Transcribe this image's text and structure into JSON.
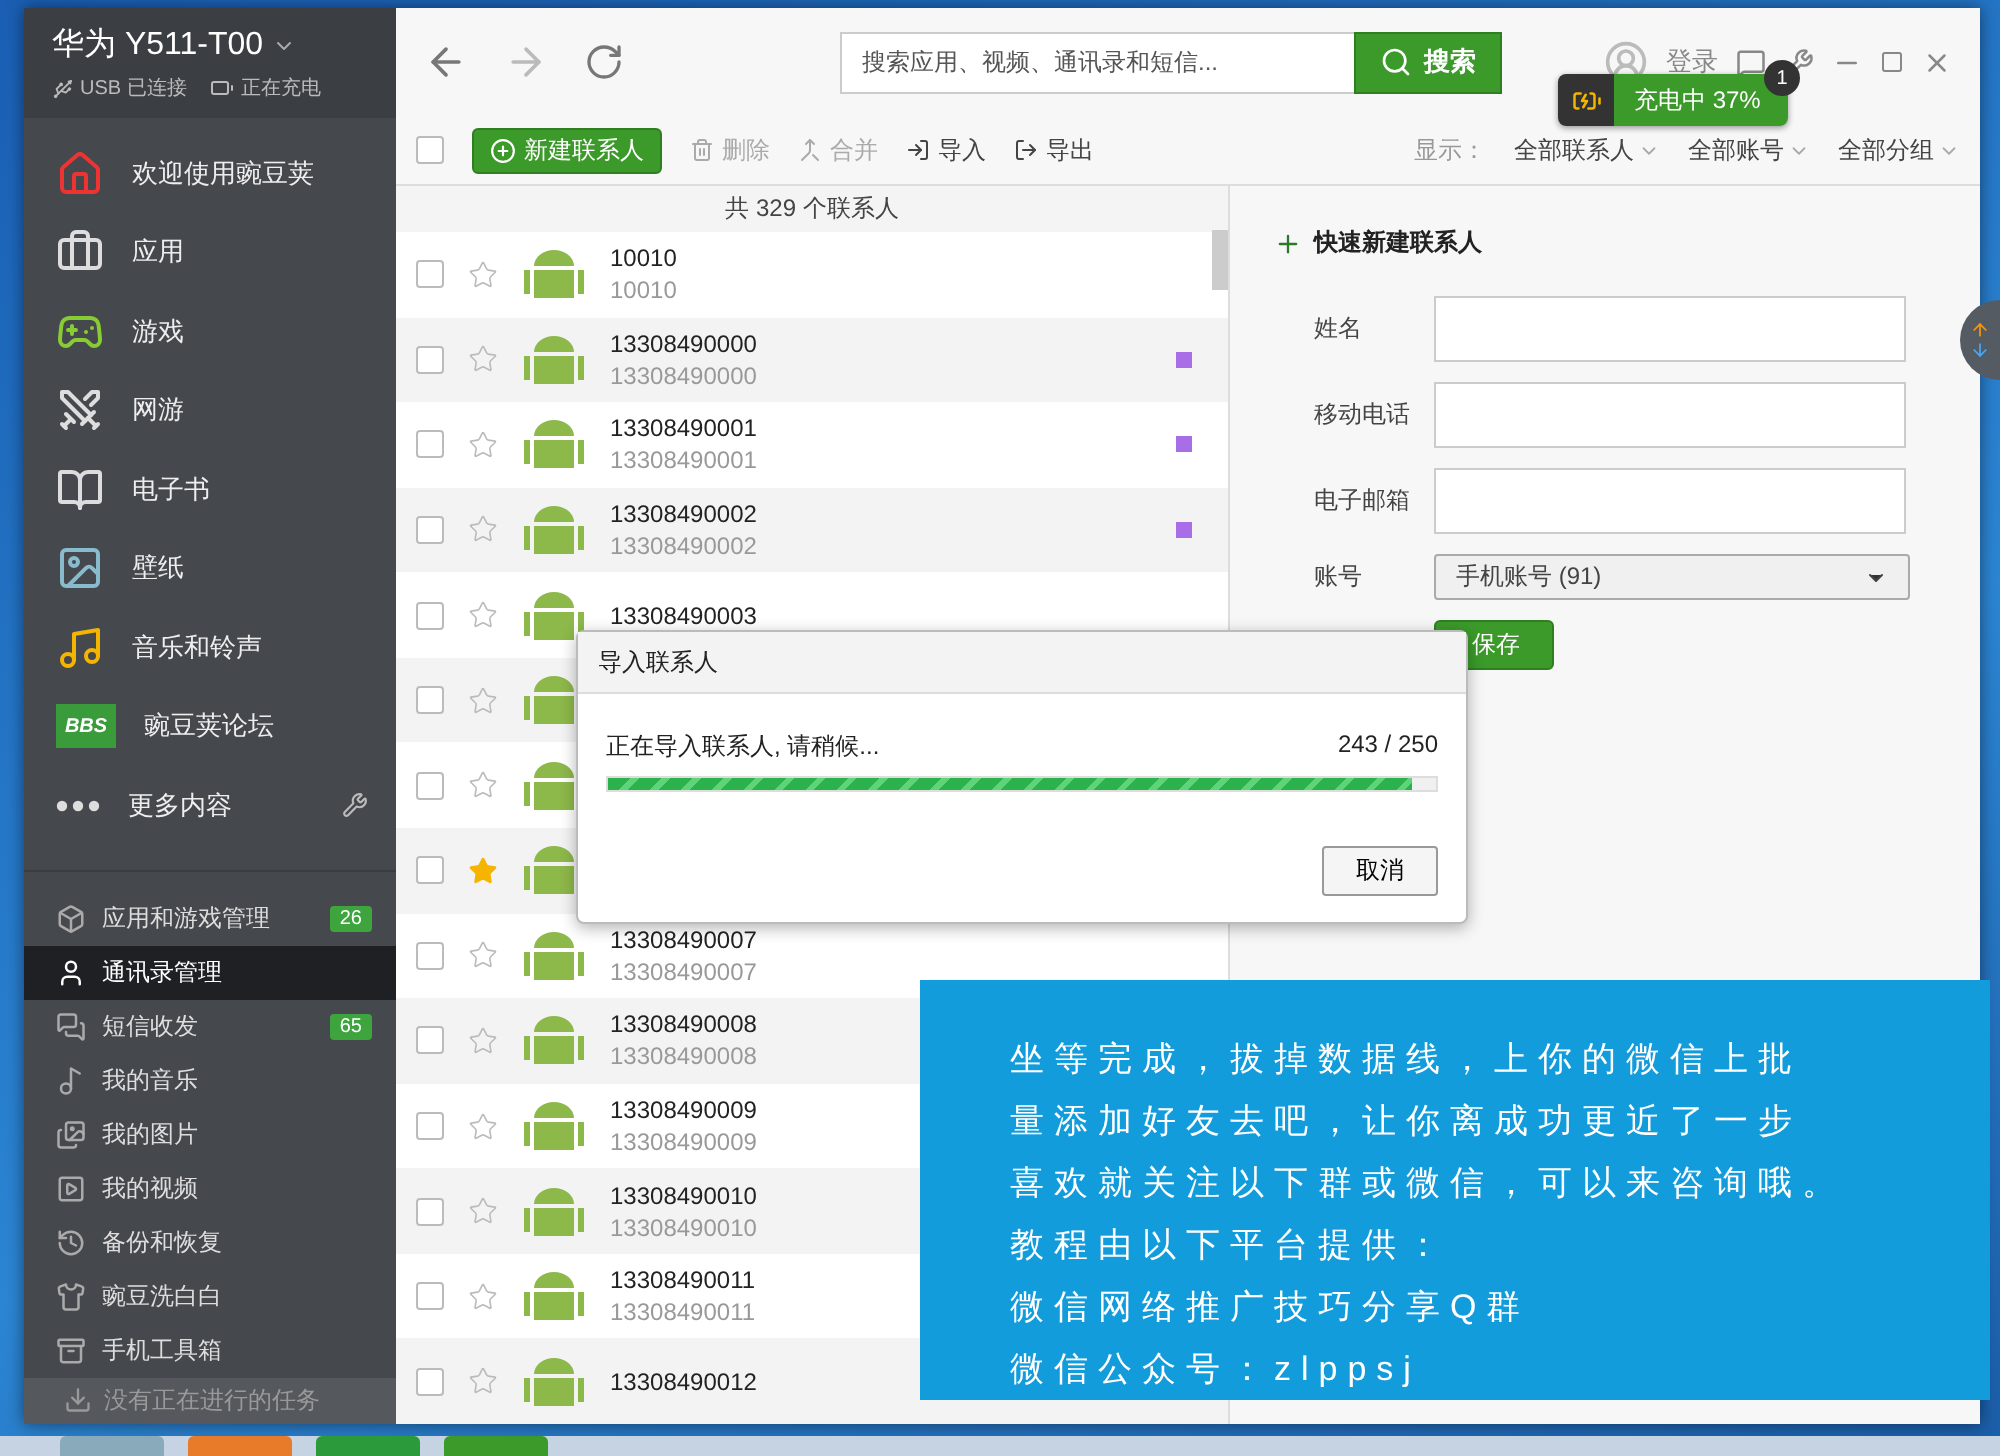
{
  "device": {
    "title": "华为 Y511-T00",
    "usb": "USB 已连接",
    "charging": "正在充电"
  },
  "sidebar": {
    "nav": [
      {
        "label": "欢迎使用豌豆荚"
      },
      {
        "label": "应用"
      },
      {
        "label": "游戏"
      },
      {
        "label": "网游"
      },
      {
        "label": "电子书"
      },
      {
        "label": "壁纸"
      },
      {
        "label": "音乐和铃声"
      },
      {
        "label": "豌豆荚论坛",
        "icon_text": "BBS"
      },
      {
        "label": "更多内容"
      }
    ],
    "manage": [
      {
        "label": "应用和游戏管理",
        "badge": "26",
        "selected": false
      },
      {
        "label": "通讯录管理",
        "selected": true
      },
      {
        "label": "短信收发",
        "badge": "65",
        "selected": false
      },
      {
        "label": "我的音乐",
        "selected": false
      },
      {
        "label": "我的图片",
        "selected": false
      },
      {
        "label": "我的视频",
        "selected": false
      },
      {
        "label": "备份和恢复",
        "selected": false
      },
      {
        "label": "豌豆洗白白",
        "selected": false
      },
      {
        "label": "手机工具箱",
        "selected": false
      }
    ],
    "tasks": "没有正在进行的任务"
  },
  "toolbar": {
    "search_placeholder": "搜索应用、视频、通讯录和短信...",
    "search_button": "搜索",
    "login": "登录"
  },
  "charge_popup": {
    "text": "充电中 37%",
    "badge": "1"
  },
  "actions": {
    "select_all_checked": false,
    "new": "新建联系人",
    "delete": "删除",
    "merge": "合并",
    "import": "导入",
    "export": "导出",
    "show_label": "显示：",
    "filters": [
      "全部联系人",
      "全部账号",
      "全部分组"
    ]
  },
  "contacts": {
    "count": "共 329 个联系人",
    "rows": [
      {
        "name": "10010",
        "number": "10010",
        "checked": false,
        "starred": false
      },
      {
        "name": "13308490000",
        "number": "13308490000",
        "checked": false,
        "starred": false,
        "color": "#a86ee8"
      },
      {
        "name": "13308490001",
        "number": "13308490001",
        "checked": false,
        "starred": false,
        "color": "#a86ee8"
      },
      {
        "name": "13308490002",
        "number": "13308490002",
        "checked": false,
        "starred": false,
        "color": "#a86ee8"
      },
      {
        "name": "13308490003",
        "checked": false,
        "starred": false
      },
      {
        "checked": false,
        "starred": false
      },
      {
        "checked": false,
        "starred": false
      },
      {
        "checked": false,
        "starred": true
      },
      {
        "name": "13308490007",
        "number": "13308490007",
        "checked": false,
        "starred": false
      },
      {
        "name": "13308490008",
        "number": "13308490008",
        "checked": false,
        "starred": false
      },
      {
        "name": "13308490009",
        "number": "13308490009",
        "checked": false,
        "starred": false
      },
      {
        "name": "13308490010",
        "number": "13308490010",
        "checked": false,
        "starred": false
      },
      {
        "name": "13308490011",
        "number": "13308490011",
        "checked": false,
        "starred": false
      },
      {
        "name": "13308490012",
        "checked": false,
        "starred": false
      }
    ]
  },
  "quick_add": {
    "title": "快速新建联系人",
    "fields": [
      {
        "label": "姓名",
        "kind": "text"
      },
      {
        "label": "移动电话",
        "kind": "text"
      },
      {
        "label": "电子邮箱",
        "kind": "text"
      },
      {
        "label": "账号",
        "kind": "select",
        "value": "手机账号 (91)"
      }
    ],
    "save": "保存"
  },
  "import_dialog": {
    "title": "导入联系人",
    "message": "正在导入联系人, 请稍候...",
    "progress": "243 / 250",
    "level": 0.972,
    "cancel": "取消"
  },
  "note": [
    "坐等完成，拔掉数据线，上你的微信上批",
    "量添加好友去吧，让你离成功更近了一步",
    "喜欢就关注以下群或微信，可以来咨询哦。",
    "教程由以下平台提供：",
    "微信网络推广技巧分享Q群",
    "微信公众号：zlppsj"
  ]
}
